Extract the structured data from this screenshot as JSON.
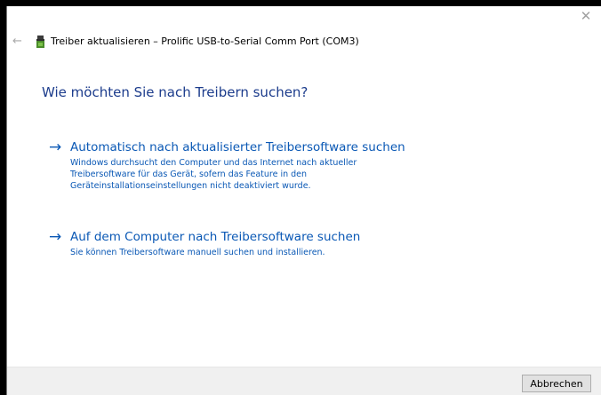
{
  "dialog": {
    "close_glyph": "✕",
    "back_glyph": "←",
    "title": "Treiber aktualisieren – Prolific USB-to-Serial Comm Port (COM3)",
    "question": "Wie möchten Sie nach Treibern suchen?",
    "device_icon": "usb-device-icon"
  },
  "options": [
    {
      "arrow": "→",
      "title": "Automatisch nach aktualisierter Treibersoftware suchen",
      "description_lines": [
        "Windows durchsucht den Computer und das Internet nach aktueller",
        "Treibersoftware für das Gerät, sofern das Feature in den",
        "Geräteinstallationseinstellungen nicht deaktiviert wurde."
      ]
    },
    {
      "arrow": "→",
      "title": "Auf dem Computer nach Treibersoftware suchen",
      "description_lines": [
        "Sie können Treibersoftware manuell suchen und installieren."
      ]
    }
  ],
  "footer": {
    "cancel_label": "Abbrechen"
  },
  "colors": {
    "link": "#0a58b5",
    "heading": "#1c3c8c",
    "footer_bg": "#f0f0f0"
  }
}
